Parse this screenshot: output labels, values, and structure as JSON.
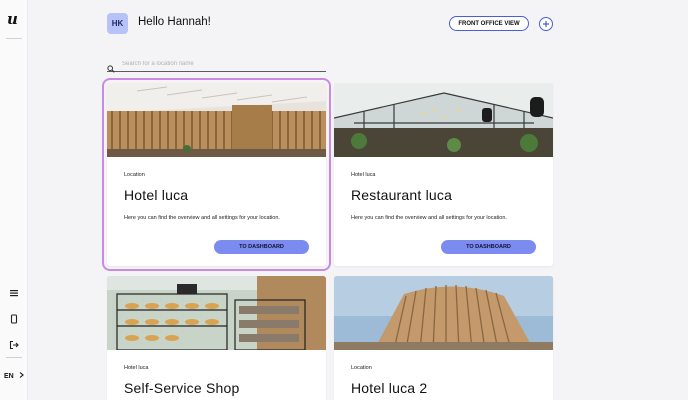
{
  "sidebar": {
    "logo": "u",
    "icons": [
      "menu-icon",
      "device-icon",
      "logout-icon"
    ],
    "language": "EN"
  },
  "header": {
    "avatar_initials": "HK",
    "greeting": "Hello Hannah!",
    "front_office_label": "FRONT OFFICE VIEW",
    "add_icon": "plus-icon"
  },
  "search": {
    "placeholder": "Search for a location name",
    "icon": "search-icon"
  },
  "cards": [
    {
      "type": "Location",
      "title": "Hotel luca",
      "description": "Here you can find the overview and all settings for your location.",
      "button": "TO DASHBOARD",
      "image": "hotel-lobby-image"
    },
    {
      "type": "Hotel luca",
      "title": "Restaurant luca",
      "description": "Here you can find the overview and all settings for your location.",
      "button": "TO DASHBOARD",
      "image": "restaurant-image"
    },
    {
      "type": "Hotel luca",
      "title": "Self-Service Shop",
      "image": "shop-image"
    },
    {
      "type": "Location",
      "title": "Hotel luca 2",
      "image": "building-exterior-image"
    }
  ],
  "colors": {
    "accent": "#7b8bf0",
    "accent_border": "#4a5ddb",
    "selection": "#c98ae6",
    "avatar_bg": "#b7c3f7"
  }
}
